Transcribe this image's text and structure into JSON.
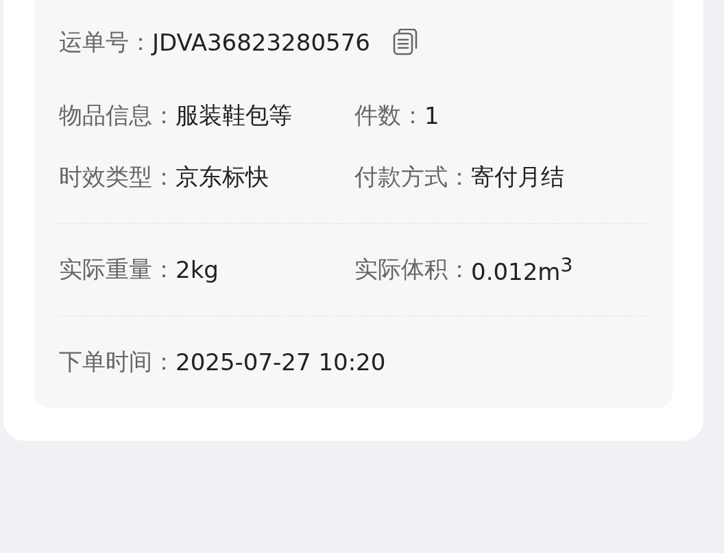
{
  "waybill": {
    "label": "运单号：",
    "value": "JDVA36823280576"
  },
  "sections": [
    {
      "rows": [
        [
          {
            "label": "物品信息：",
            "value": "服装鞋包等"
          },
          {
            "label": "件数：",
            "value": "1"
          }
        ],
        [
          {
            "label": "时效类型：",
            "value": "京东标快"
          },
          {
            "label": "付款方式：",
            "value": "寄付月结"
          }
        ]
      ]
    },
    {
      "rows": [
        [
          {
            "label": "实际重量：",
            "value": "2kg"
          },
          {
            "label": "实际体积：",
            "value": "0.012m$^{3}$"
          }
        ]
      ]
    },
    {
      "rows": [
        [
          {
            "label": "下单时间：",
            "value": "2025-07-27 10:20"
          }
        ]
      ]
    }
  ]
}
